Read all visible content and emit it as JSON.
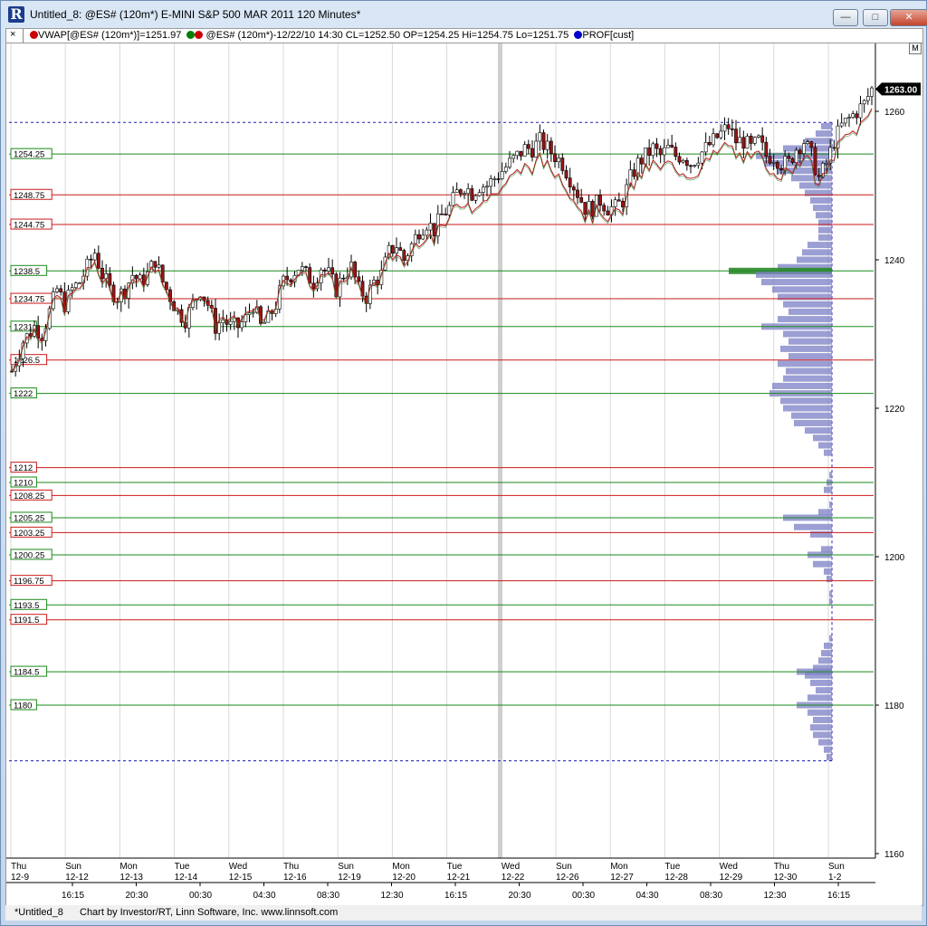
{
  "window": {
    "title": "Untitled_8: @ES# (120m*) E-MINI S&P 500 MAR 2011 120 Minutes*",
    "logo_letter": "R",
    "min_symbol": "—",
    "max_symbol": "□",
    "close_symbol": "✕"
  },
  "toolbar": {
    "close_glyph": "×",
    "vwap_label": "VWAP[@ES# (120m*)]=1251.97",
    "bar_label": "@ES# (120m*)-12/22/10 14:30 CL=1252.50 OP=1254.25 Hi=1254.75 Lo=1251.75",
    "prof_label": "PROF[cust]",
    "colors": {
      "vwap": "#cc0000",
      "bar_up": "#008000",
      "bar_down": "#cc0000",
      "prof": "#0000cc"
    }
  },
  "m_button": "M",
  "status": {
    "tab": "*Untitled_8",
    "credit": "Chart by Investor/RT, Linn Software, Inc. www.linnsoft.com"
  },
  "chart_data": {
    "type": "candlestick",
    "symbol": "@ES#",
    "interval": "120 Minutes",
    "ylim": [
      1157,
      1266
    ],
    "y_ticks": [
      1160,
      1180,
      1200,
      1220,
      1240,
      1260
    ],
    "last_price": "1263.00",
    "level_lines": [
      {
        "label": "1254.25",
        "value": 1254.25,
        "color": "green"
      },
      {
        "label": "1248.75",
        "value": 1248.75,
        "color": "red"
      },
      {
        "label": "1244.75",
        "value": 1244.75,
        "color": "red"
      },
      {
        "label": "1238.5",
        "value": 1238.5,
        "color": "green"
      },
      {
        "label": "1234.75",
        "value": 1234.75,
        "color": "red"
      },
      {
        "label": "1231",
        "value": 1231,
        "color": "green"
      },
      {
        "label": "1226.5",
        "value": 1226.5,
        "color": "red"
      },
      {
        "label": "1222",
        "value": 1222,
        "color": "green"
      },
      {
        "label": "1212",
        "value": 1212,
        "color": "red"
      },
      {
        "label": "1210",
        "value": 1210,
        "color": "green"
      },
      {
        "label": "1208.25",
        "value": 1208.25,
        "color": "red"
      },
      {
        "label": "1205.25",
        "value": 1205.25,
        "color": "green"
      },
      {
        "label": "1203.25",
        "value": 1203.25,
        "color": "red"
      },
      {
        "label": "1200.25",
        "value": 1200.25,
        "color": "green"
      },
      {
        "label": "1196.75",
        "value": 1196.75,
        "color": "red"
      },
      {
        "label": "1193.5",
        "value": 1193.5,
        "color": "green"
      },
      {
        "label": "1191.5",
        "value": 1191.5,
        "color": "red"
      },
      {
        "label": "1184.5",
        "value": 1184.5,
        "color": "green"
      },
      {
        "label": "1180",
        "value": 1180,
        "color": "green"
      }
    ],
    "profile_range": [
      1172.5,
      1258.5
    ],
    "date_axis": [
      {
        "day": "Thu",
        "date": "12-9"
      },
      {
        "day": "Sun",
        "date": "12-12"
      },
      {
        "day": "Mon",
        "date": "12-13"
      },
      {
        "day": "Tue",
        "date": "12-14"
      },
      {
        "day": "Wed",
        "date": "12-15"
      },
      {
        "day": "Thu",
        "date": "12-16"
      },
      {
        "day": "Sun",
        "date": "12-19"
      },
      {
        "day": "Mon",
        "date": "12-20"
      },
      {
        "day": "Tue",
        "date": "12-21"
      },
      {
        "day": "Wed",
        "date": "12-22"
      },
      {
        "day": "Sun",
        "date": "12-26"
      },
      {
        "day": "Mon",
        "date": "12-27"
      },
      {
        "day": "Tue",
        "date": "12-28"
      },
      {
        "day": "Wed",
        "date": "12-29"
      },
      {
        "day": "Thu",
        "date": "12-30"
      },
      {
        "day": "Sun",
        "date": "1-2"
      }
    ],
    "time_axis": [
      "16:15",
      "20:30",
      "00:30",
      "04:30",
      "08:30",
      "12:30",
      "16:15",
      "20:30",
      "00:30",
      "04:30",
      "08:30",
      "12:30",
      "16:15"
    ],
    "close_path": [
      [
        0,
        1225
      ],
      [
        3,
        1229
      ],
      [
        6,
        1231
      ],
      [
        8,
        1230
      ],
      [
        10,
        1233
      ],
      [
        12,
        1236
      ],
      [
        14,
        1234
      ],
      [
        16,
        1236
      ],
      [
        18,
        1237
      ],
      [
        20,
        1239
      ],
      [
        22,
        1241
      ],
      [
        24,
        1238
      ],
      [
        26,
        1236
      ],
      [
        28,
        1235
      ],
      [
        30,
        1236
      ],
      [
        32,
        1238
      ],
      [
        34,
        1237
      ],
      [
        36,
        1238
      ],
      [
        38,
        1240
      ],
      [
        40,
        1237
      ],
      [
        42,
        1235
      ],
      [
        44,
        1233
      ],
      [
        46,
        1232
      ],
      [
        48,
        1234
      ],
      [
        50,
        1236
      ],
      [
        52,
        1234
      ],
      [
        54,
        1231
      ],
      [
        56,
        1232
      ],
      [
        58,
        1231
      ],
      [
        60,
        1231
      ],
      [
        62,
        1232
      ],
      [
        64,
        1234
      ],
      [
        66,
        1231
      ],
      [
        68,
        1232
      ],
      [
        70,
        1234
      ],
      [
        72,
        1237
      ],
      [
        74,
        1238
      ],
      [
        76,
        1239
      ],
      [
        78,
        1238
      ],
      [
        80,
        1237
      ],
      [
        82,
        1239
      ],
      [
        84,
        1238
      ],
      [
        86,
        1236
      ],
      [
        88,
        1238
      ],
      [
        90,
        1239
      ],
      [
        92,
        1236
      ],
      [
        94,
        1235
      ],
      [
        96,
        1237
      ],
      [
        98,
        1238
      ],
      [
        100,
        1241
      ],
      [
        102,
        1242
      ],
      [
        104,
        1240
      ],
      [
        106,
        1242
      ],
      [
        108,
        1244
      ],
      [
        110,
        1245
      ],
      [
        112,
        1244
      ],
      [
        114,
        1246
      ],
      [
        116,
        1247
      ],
      [
        118,
        1249
      ],
      [
        120,
        1250
      ],
      [
        122,
        1249
      ],
      [
        124,
        1250
      ],
      [
        126,
        1250
      ],
      [
        128,
        1251
      ],
      [
        130,
        1252
      ],
      [
        132,
        1253
      ],
      [
        134,
        1254
      ],
      [
        136,
        1255
      ],
      [
        138,
        1255
      ],
      [
        140,
        1256
      ],
      [
        142,
        1255
      ],
      [
        144,
        1254
      ],
      [
        146,
        1253
      ],
      [
        148,
        1251
      ],
      [
        150,
        1249
      ],
      [
        152,
        1247
      ],
      [
        154,
        1247
      ],
      [
        156,
        1248
      ],
      [
        158,
        1247
      ],
      [
        160,
        1247
      ],
      [
        162,
        1248
      ],
      [
        164,
        1251
      ],
      [
        166,
        1253
      ],
      [
        168,
        1254
      ],
      [
        170,
        1255
      ],
      [
        172,
        1254
      ],
      [
        174,
        1255
      ],
      [
        176,
        1254
      ],
      [
        178,
        1254
      ],
      [
        180,
        1253
      ],
      [
        182,
        1254
      ],
      [
        184,
        1255
      ],
      [
        186,
        1256
      ],
      [
        188,
        1257
      ],
      [
        190,
        1258
      ],
      [
        192,
        1256
      ],
      [
        194,
        1256
      ],
      [
        196,
        1255
      ],
      [
        198,
        1256
      ],
      [
        200,
        1254
      ],
      [
        202,
        1254
      ],
      [
        204,
        1253
      ],
      [
        206,
        1253
      ],
      [
        208,
        1255
      ],
      [
        210,
        1256
      ],
      [
        212,
        1254
      ],
      [
        214,
        1251
      ],
      [
        216,
        1253
      ],
      [
        218,
        1256
      ],
      [
        220,
        1258
      ],
      [
        222,
        1259
      ],
      [
        224,
        1260
      ],
      [
        226,
        1261
      ],
      [
        228,
        1263
      ]
    ],
    "volume_profile": [
      [
        1258,
        4
      ],
      [
        1257,
        6
      ],
      [
        1256,
        10
      ],
      [
        1255,
        18
      ],
      [
        1254,
        28
      ],
      [
        1253,
        25
      ],
      [
        1252,
        20
      ],
      [
        1251,
        15
      ],
      [
        1250,
        12
      ],
      [
        1249,
        10
      ],
      [
        1248,
        8
      ],
      [
        1247,
        7
      ],
      [
        1246,
        6
      ],
      [
        1245,
        5
      ],
      [
        1244,
        5
      ],
      [
        1243,
        5
      ],
      [
        1242,
        9
      ],
      [
        1241,
        11
      ],
      [
        1240,
        13
      ],
      [
        1239,
        20
      ],
      [
        1238.5,
        38
      ],
      [
        1238,
        28
      ],
      [
        1237,
        26
      ],
      [
        1236,
        22
      ],
      [
        1235,
        20
      ],
      [
        1234,
        18
      ],
      [
        1233,
        16
      ],
      [
        1232,
        20
      ],
      [
        1231,
        26
      ],
      [
        1230,
        18
      ],
      [
        1229,
        16
      ],
      [
        1228,
        19
      ],
      [
        1227,
        16
      ],
      [
        1226,
        20
      ],
      [
        1225,
        17
      ],
      [
        1224,
        18
      ],
      [
        1223,
        22
      ],
      [
        1222,
        23
      ],
      [
        1221,
        19
      ],
      [
        1220,
        18
      ],
      [
        1219,
        15
      ],
      [
        1218,
        14
      ],
      [
        1217,
        10
      ],
      [
        1216,
        7
      ],
      [
        1215,
        5
      ],
      [
        1214,
        3
      ],
      [
        1211,
        1
      ],
      [
        1210,
        2
      ],
      [
        1209,
        3
      ],
      [
        1207,
        1
      ],
      [
        1206,
        5
      ],
      [
        1205.25,
        18
      ],
      [
        1204,
        14
      ],
      [
        1203,
        8
      ],
      [
        1201,
        4
      ],
      [
        1200.25,
        9
      ],
      [
        1199,
        7
      ],
      [
        1198,
        3
      ],
      [
        1197,
        2
      ],
      [
        1195,
        1
      ],
      [
        1194,
        1
      ],
      [
        1189,
        1
      ],
      [
        1188,
        3
      ],
      [
        1187,
        4
      ],
      [
        1186,
        5
      ],
      [
        1185,
        7
      ],
      [
        1184.5,
        13
      ],
      [
        1184,
        10
      ],
      [
        1183,
        8
      ],
      [
        1182,
        6
      ],
      [
        1181,
        9
      ],
      [
        1180,
        13
      ],
      [
        1179,
        9
      ],
      [
        1178,
        7
      ],
      [
        1177,
        8
      ],
      [
        1176,
        7
      ],
      [
        1175,
        5
      ],
      [
        1174,
        3
      ],
      [
        1173,
        2
      ]
    ]
  }
}
